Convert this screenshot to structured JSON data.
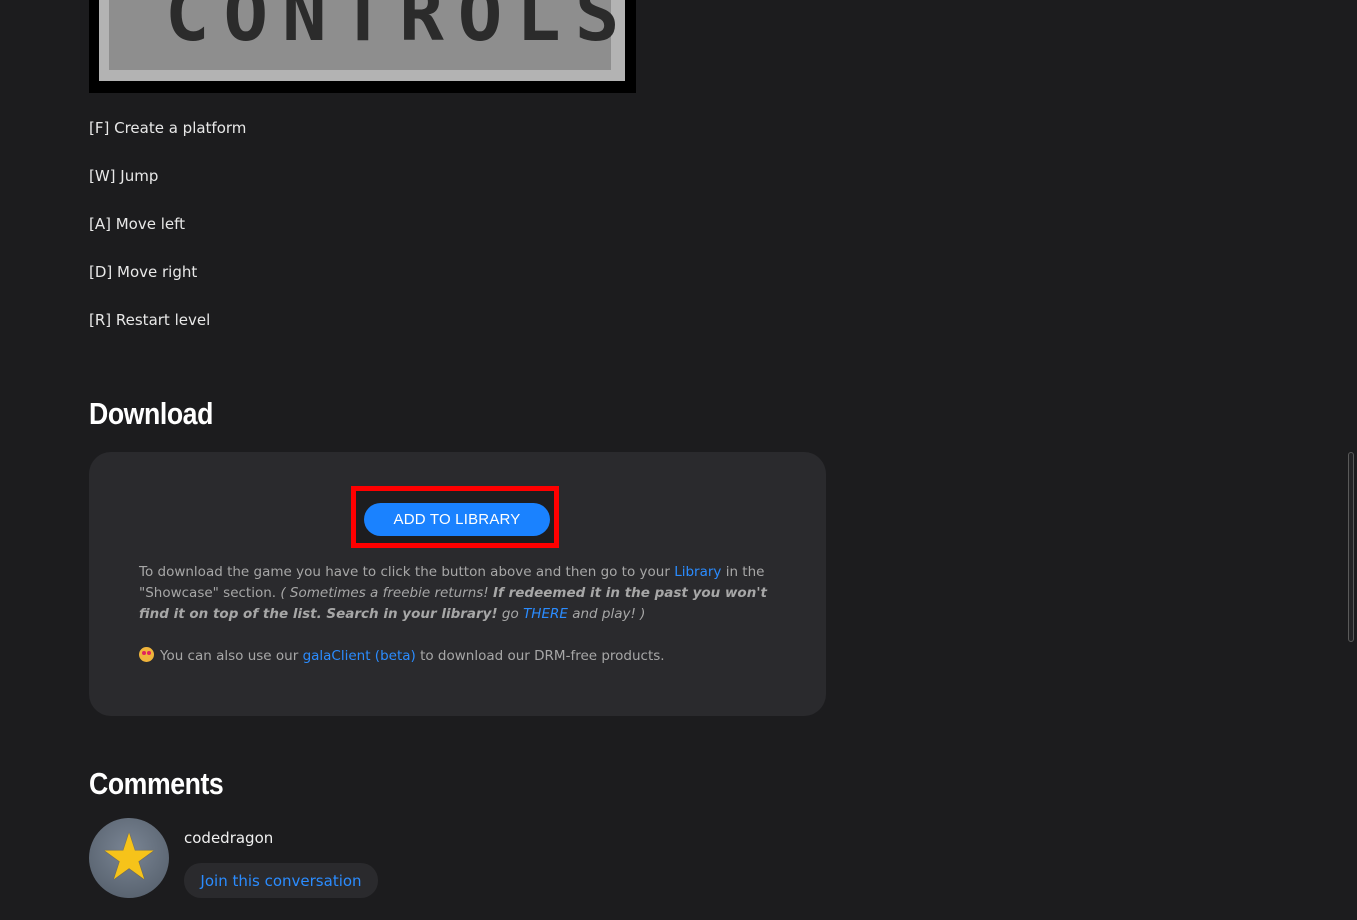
{
  "banner": {
    "text": "CONTROLS"
  },
  "controls": [
    "[F] Create a platform",
    "[W] Jump",
    "[A] Move left",
    "[D] Move right",
    "[R] Restart level"
  ],
  "download": {
    "title": "Download",
    "add_button": "ADD TO LIBRARY",
    "text_1": "To download the game you have to click the button above and then go to your ",
    "library_link": "Library",
    "text_2": " in the \"Showcase\" section. ",
    "italic_1": "( Sometimes a freebie returns! ",
    "bold_italic": "If redeemed it in the past you won't find it on top of the list. Search in your library!",
    "italic_2": " go ",
    "there_link": "THERE",
    "italic_3": " and play! )",
    "client_text_1": "You can also use our ",
    "client_link": "galaClient (beta)",
    "client_text_2": " to download our DRM-free products."
  },
  "comments": {
    "title": "Comments",
    "username": "codedragon",
    "join_button": "Join this conversation"
  },
  "colors": {
    "background": "#1c1c1e",
    "box": "#2a2a2d",
    "accent": "#1a82ff",
    "highlight": "#ff0000"
  }
}
